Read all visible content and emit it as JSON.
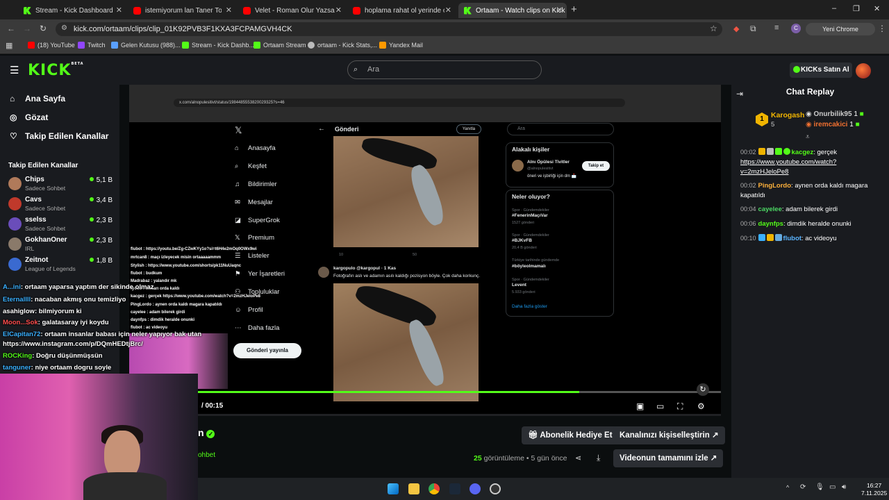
{
  "tabs": [
    {
      "title": "Stream - Kick Dashboard",
      "icon": "kick"
    },
    {
      "title": "istemiyorum lan Taner Tolga Ta",
      "icon": "youtube"
    },
    {
      "title": "Velet - Roman Olur Yazsam Sen",
      "icon": "youtube"
    },
    {
      "title": "hoplama rahat ol yerinde otur",
      "icon": "youtube"
    },
    {
      "title": "Ortaam - Watch clips on Kick",
      "icon": "kick",
      "active": true
    }
  ],
  "new_tab": "+",
  "window": {
    "minimize": "–",
    "restore": "❐",
    "close": "✕"
  },
  "url": "kick.com/ortaam/clips/clip_01K92PVB3F1KXA3FCPAMGVH4CK",
  "profile_button": "Yeni Chrome kullanılabilir",
  "bookmarks": [
    {
      "label": "(18) YouTube",
      "color": "#ff0000"
    },
    {
      "label": "Twitch",
      "color": "#9146ff"
    },
    {
      "label": "Gelen Kutusu (988)...",
      "color": "#5aa0ff"
    },
    {
      "label": "Stream - Kick Dashb...",
      "color": "#53fc18"
    },
    {
      "label": "Ortaam Stream",
      "color": "#53fc18"
    },
    {
      "label": "ortaam - Kick Stats,...",
      "color": "#bbbbbb"
    },
    {
      "label": "Yandex Mail",
      "color": "#ff9900"
    }
  ],
  "header": {
    "logo": "KICK",
    "logo_sup": "BETA",
    "search_placeholder": "Ara",
    "kicks_button": "KICKs Satın Al"
  },
  "sidebar": {
    "nav": [
      {
        "label": "Ana Sayfa",
        "icon": "home-icon"
      },
      {
        "label": "Gözat",
        "icon": "compass-icon"
      },
      {
        "label": "Takip Edilen Kanallar",
        "icon": "heart-icon"
      }
    ],
    "followed_title": "Takip Edilen Kanallar",
    "channels": [
      {
        "name": "Chips",
        "sub": "Sadece Sohbet",
        "viewers": "5,1 B",
        "color": "#b07a5a"
      },
      {
        "name": "Cavs",
        "sub": "Sadece Sohbet",
        "viewers": "3,4 B",
        "color": "#c0392b"
      },
      {
        "name": "sselss",
        "sub": "Sadece Sohbet",
        "viewers": "2,3 B",
        "color": "#6a4dba"
      },
      {
        "name": "GokhanOner",
        "sub": "IRL",
        "viewers": "2,3 B",
        "color": "#8a7a6a"
      },
      {
        "name": "Zeitnot",
        "sub": "League of Legends",
        "viewers": "1,8 B",
        "color": "#3a6ad0"
      }
    ]
  },
  "overlay_chat": [
    {
      "user": "A...ini",
      "text": ": ortaam yaparsa yaptım der sikinde olmaz"
    },
    {
      "user": "Eternallll",
      "text": ": nacaban akmış onu temizliyo"
    },
    {
      "user": "asahiglow",
      "text": ": bilmiyorum ki"
    },
    {
      "user": "Moon...Sok",
      "text": ": galatasaray iyi koydu"
    },
    {
      "user": "ElCapitan72",
      "text": ": ortaam insanlar babası için neler yapıyor bak utan"
    },
    {
      "user": "",
      "text": "https://www.instagram.com/p/DQmHEDtjBrc/"
    },
    {
      "user": "ROCKing",
      "text": ": Doğru düşünmüşsün"
    },
    {
      "user": "tanguner",
      "text": ": niye ortaam dogru soyle"
    }
  ],
  "inner_chat": [
    "flubot : https://youtu.be/Zg-CZwKYy1o?si=t6H4e2mOq0OWx9wi",
    "mrtcan8 : maçı izleyecek misin ortaaaaammm",
    "Stylish : https://www.youtube.com/shorts/pk11NuUaqnc",
    "flubot : budkum",
    "Madrabaz : yalandır mk",
    "fyooo : Mezarı orda kaldı",
    "kacgez : gerçek https://www.youtube.com/watch?v=2mzHJeloPe8",
    "PingLordo : aynen orda kaldı magara kapatıldı",
    "cayelee : adam bilerek girdi",
    "daynfps : dimdik heralde onunki",
    "flubot : ac videoyu"
  ],
  "x_page": {
    "url": "x.com/alnopulesitivt/status/1984485553820029325?s=46",
    "nav": [
      "Anasayfa",
      "Keşfet",
      "Bildirimler",
      "Mesajlar",
      "SuperGrok",
      "Premium",
      "Listeler",
      "Yer İşaretleri",
      "Topluluklar",
      "Profil",
      "Daha fazla"
    ],
    "post_button": "Gönderi yayınla",
    "column_title": "Gönderi",
    "reply_button": "Yanıtla",
    "search": "Ara",
    "related_title": "Alakalı kişiler",
    "related_name": "Alnı Öpülesi Tivitler",
    "related_handle": "@alnopulesitivt",
    "related_bio": "öneri ve işbirliği için dm 📩",
    "follow": "Takip et",
    "trending_title": "Neler oluyor?",
    "trends": [
      {
        "cat": "Spor · Gündemdekiler",
        "tag": "#FenerinMaçıVar",
        "count": "1527 gönderi"
      },
      {
        "cat": "Spor · Gündemdekiler",
        "tag": "#BJKvFB",
        "count": "20,4 B gönderi"
      },
      {
        "cat": "Türkiye tarihinde gündemde",
        "tag": "#böyleolmamalı",
        "count": ""
      },
      {
        "cat": "Spor · Gündemdekiler",
        "tag": "Levent",
        "count": "5.933 gönderi"
      }
    ],
    "more": "Daha fazla göster",
    "post2_user": "kargopulo @kargopul · 1 Kas",
    "post2_text": "Fotoğrafın aslı ve adamın asılı kaldığı pozisyon böyle. Çok daha korkunç.",
    "post1_stats": [
      "10",
      "",
      "50",
      ""
    ]
  },
  "video": {
    "time": "/ 00:15",
    "progress": 0.76
  },
  "below": {
    "channel": "n",
    "category": "ohbet",
    "gift_button": "Abonelik Hediye Et",
    "customize_button": "Kanalınızı kişiselleştirin",
    "views": "25",
    "views_label": "görüntüleme",
    "ago": "5 gün önce",
    "watch_full": "Videonun tamamını izle"
  },
  "chat": {
    "title": "Chat Replay",
    "top": [
      {
        "rank": "1",
        "name": "Karogash",
        "count": "5"
      },
      {
        "name": "Onurbilik95",
        "count": "1"
      },
      {
        "name": "iremcakici",
        "count": "1"
      }
    ],
    "messages": [
      {
        "time": "00:02",
        "user": "kacgez",
        "color": "#53fc18",
        "text": "gerçek",
        "link": "https://www.youtube.com/watch?v=2mzHJeloPe8"
      },
      {
        "time": "00:02",
        "user": "PingLordo",
        "color": "#ffb13b",
        "text": "aynen orda kaldı magara kapatıldı"
      },
      {
        "time": "00:04",
        "user": "cayelee",
        "color": "#4cd964",
        "text": "adam bilerek girdi"
      },
      {
        "time": "00:06",
        "user": "daynfps",
        "color": "#53fc18",
        "text": "dimdik heralde onunki"
      },
      {
        "time": "00:10",
        "user": "flubot",
        "color": "#5ab4ff",
        "text": "ac videoyu"
      }
    ]
  },
  "taskbar": {
    "time": "16:27",
    "date": "7.11.2025"
  }
}
